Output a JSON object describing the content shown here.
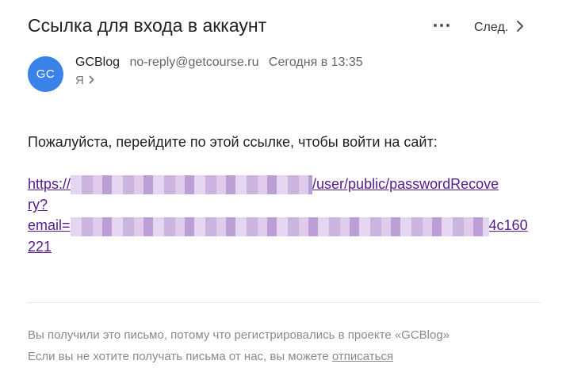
{
  "email": {
    "subject": "Ссылка для входа в аккаунт",
    "actions": {
      "next_label": "След."
    },
    "sender": {
      "initials": "GC",
      "name": "GCBlog",
      "email": "no-reply@getcourse.ru",
      "date": "Сегодня в 13:35",
      "avatar_color": "#3b82e8"
    },
    "recipient": "Я",
    "body": {
      "intro": "Пожалуйста, перейдите по этой ссылке, чтобы войти на сайт:",
      "link": {
        "line1_start": "https://",
        "line1_end": "/user/public/passwordRecove",
        "line2": "ry?",
        "line3_start": "email=",
        "line3_end": "4c160",
        "line4": "221",
        "color": "#551a8b"
      }
    },
    "footer": {
      "line1": "Вы получили это письмо, потому что регистрировались в проекте «GCBlog»",
      "line2_text": "Если вы не хотите получать письма от нас, вы можете",
      "unsubscribe_label": "отписаться"
    }
  }
}
